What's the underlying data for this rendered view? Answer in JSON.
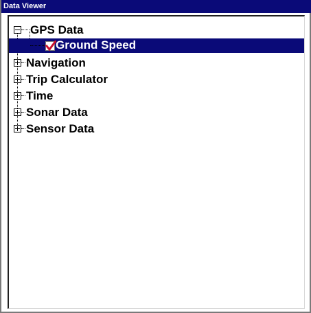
{
  "window": {
    "title": "Data Viewer"
  },
  "tree": {
    "items": [
      {
        "label": "GPS Data",
        "expanded": true,
        "icon": "minus-box-icon",
        "children": [
          {
            "label": "Ground Speed",
            "checked": true,
            "selected": true,
            "icon": "checkmark-icon"
          }
        ]
      },
      {
        "label": "Navigation",
        "expanded": false,
        "icon": "plus-box-icon"
      },
      {
        "label": "Trip Calculator",
        "expanded": false,
        "icon": "plus-box-icon"
      },
      {
        "label": "Time",
        "expanded": false,
        "icon": "plus-box-icon"
      },
      {
        "label": "Sonar Data",
        "expanded": false,
        "icon": "plus-box-icon"
      },
      {
        "label": "Sensor Data",
        "expanded": false,
        "icon": "plus-box-icon"
      }
    ]
  },
  "colors": {
    "title_bar": "#0a0a78",
    "selection": "#0a0a78",
    "checkmark": "#c8102e"
  }
}
